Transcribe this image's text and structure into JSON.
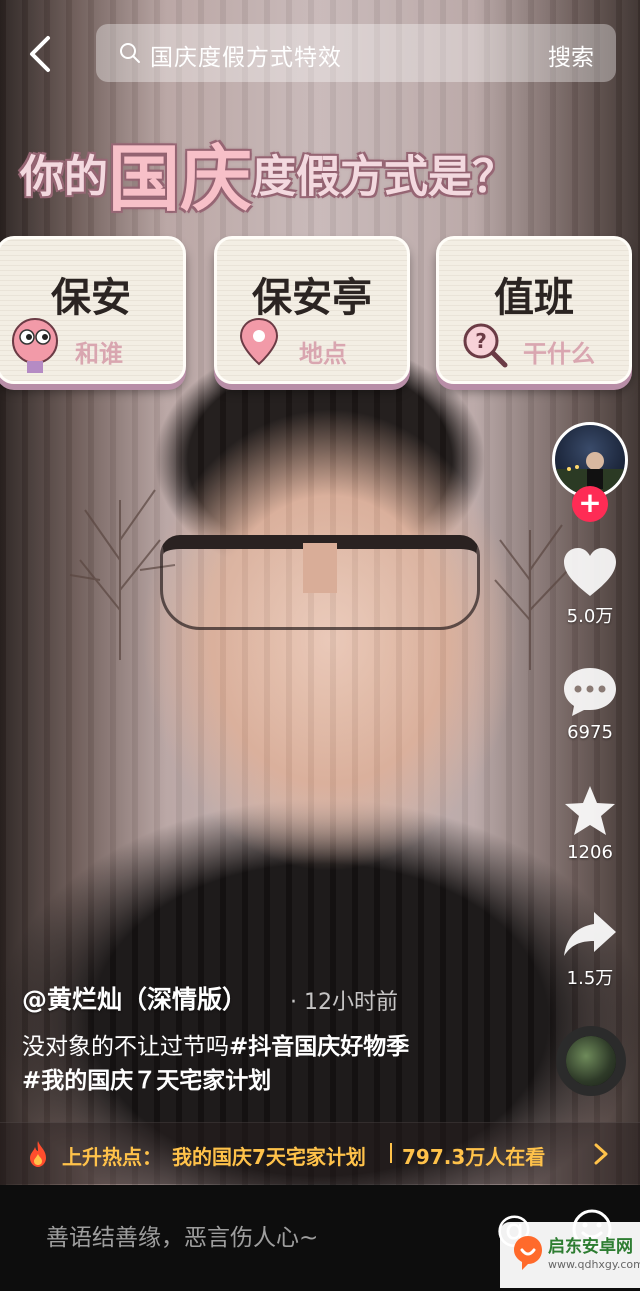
{
  "search": {
    "query": "国庆度假方式特效",
    "button": "搜索"
  },
  "effect": {
    "title_prefix": "你的",
    "title_big": "国庆",
    "title_suffix": "度假方式是？",
    "cards": [
      {
        "main": "保安",
        "sub": "和谁",
        "icon": "face-icon"
      },
      {
        "main": "保安亭",
        "sub": "地点",
        "icon": "location-pin-icon"
      },
      {
        "main": "值班",
        "sub": "干什么",
        "icon": "question-magnifier-icon"
      }
    ]
  },
  "sidebar": {
    "likes": "5.0万",
    "comments": "6975",
    "favorites": "1206",
    "shares": "1.5万",
    "follow": "+"
  },
  "post": {
    "author": "@黄烂灿（深情版）",
    "time": "· 12小时前",
    "desc_text": "没对象的不让过节吗",
    "tag1": "#抖音国庆好物季",
    "tag2": "#我的国庆７天宅家计划"
  },
  "hot": {
    "label": "上升热点：",
    "topic": "我的国庆7天宅家计划",
    "count": "797.3万人在看"
  },
  "comment": {
    "placeholder": "善语结善缘，恶言伤人心~",
    "at": "@"
  },
  "watermark": {
    "name": "启东安卓网",
    "url": "www.qdhxgy.com"
  },
  "colors": {
    "accent": "#fe2c55",
    "hot": "#ffc24a",
    "card_shadow": "#b88ea7"
  }
}
